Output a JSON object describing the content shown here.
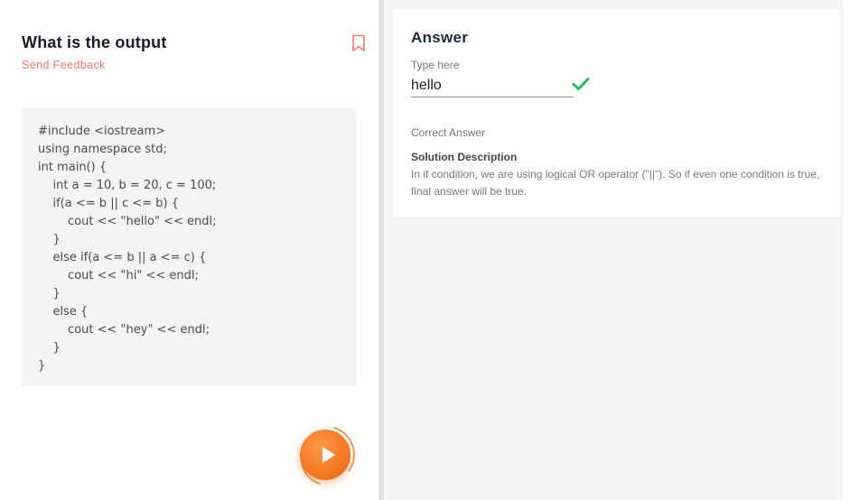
{
  "question": {
    "title": "What is the output",
    "send_feedback": "Send Feedback",
    "bookmark_icon": "bookmark-icon",
    "code_lines": [
      "#include <iostream>",
      "using namespace std;",
      "int main() {",
      "    int a = 10, b = 20, c = 100;",
      "    if(a <= b || c <= b) {",
      "        cout << \"hello\" << endl;",
      "    }",
      "    else if(a <= b || a <= c) {",
      "        cout << \"hi\" << endl;",
      "    }",
      "    else {",
      "        cout << \"hey\" << endl;",
      "    }",
      "}"
    ],
    "play_icon": "play-icon"
  },
  "answer": {
    "heading": "Answer",
    "input_label": "Type here",
    "input_value": "hello",
    "status_icon": "check-icon",
    "correct_label": "Correct Answer",
    "solution_title": "Solution Description",
    "solution_text": "In if condition, we are using logical OR operator (\"||\"). So if even one condition is true, final answer will be true."
  },
  "colors": {
    "accent_orange": "#f57a25",
    "feedback_red": "#f47b6a",
    "success_green": "#2ebd59"
  }
}
